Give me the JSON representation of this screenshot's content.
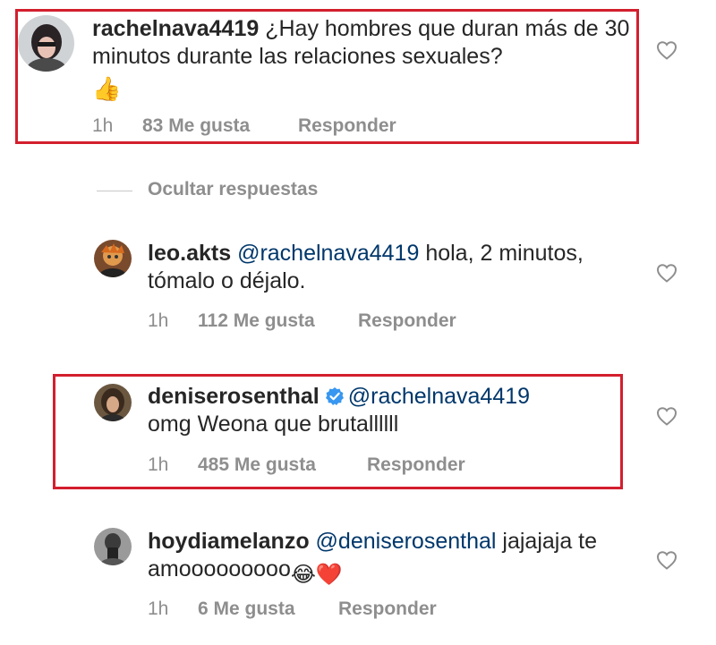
{
  "hide_replies_label": "Ocultar respuestas",
  "comments": [
    {
      "username": "rachelnava4419",
      "text": "¿Hay hombres que duran más de 30 minutos durante las relaciones sexuales?",
      "emoji": "👍",
      "time": "1h",
      "likes": "83 Me gusta",
      "reply": "Responder"
    },
    {
      "username": "leo.akts",
      "mention": "@rachelnava4419",
      "text": "hola, 2 minutos, tómalo o déjalo.",
      "time": "1h",
      "likes": "112 Me gusta",
      "reply": "Responder"
    },
    {
      "username": "deniserosenthal",
      "verified": true,
      "mention": "@rachelnava4419",
      "text": "omg Weona que brutallllll",
      "time": "1h",
      "likes": "485 Me gusta",
      "reply": "Responder"
    },
    {
      "username": "hoydiamelanzo",
      "mention": "@deniserosenthal",
      "text": "jajajaja te amooooooooo",
      "emoji": "😂❤️",
      "time": "1h",
      "likes": "6 Me gusta",
      "reply": "Responder"
    }
  ],
  "colors": {
    "highlight": "#d31f2e",
    "mention": "#00376b",
    "meta": "#8e8e8e",
    "text": "#262626"
  },
  "icons": {
    "like": "heart-outline-icon",
    "verified": "verified-badge-icon"
  }
}
